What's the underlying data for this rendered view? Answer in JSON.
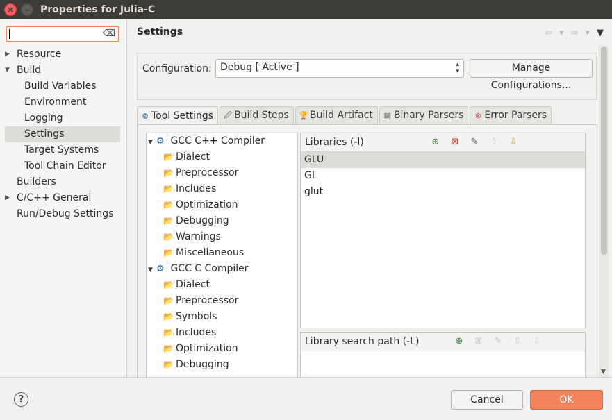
{
  "window": {
    "title": "Properties for Julia-C",
    "close_glyph": "×",
    "minimize_glyph": "–"
  },
  "filter": {
    "value": "",
    "clear_glyph": "⌫"
  },
  "sidebar": {
    "items": [
      {
        "label": "Resource",
        "arrow": "▶"
      },
      {
        "label": "Build",
        "arrow": "▼"
      },
      {
        "label": "Build Variables",
        "arrow": ""
      },
      {
        "label": "Environment",
        "arrow": ""
      },
      {
        "label": "Logging",
        "arrow": ""
      },
      {
        "label": "Settings",
        "arrow": ""
      },
      {
        "label": "Target Systems",
        "arrow": ""
      },
      {
        "label": "Tool Chain Editor",
        "arrow": ""
      },
      {
        "label": "Builders",
        "arrow": ""
      },
      {
        "label": "C/C++ General",
        "arrow": "▶"
      },
      {
        "label": "Run/Debug Settings",
        "arrow": ""
      }
    ],
    "selected": "Settings"
  },
  "main": {
    "title": "Settings",
    "nav": {
      "back": "⇦",
      "back_menu": "▾",
      "forward": "⇨",
      "forward_menu": "▾",
      "view_menu": "▼"
    },
    "configuration": {
      "label": "Configuration:",
      "value": "Debug  [ Active ]",
      "manage_label": "Manage Configurations...",
      "spinner_glyph": "▴▾"
    },
    "tabs": [
      {
        "label": "Tool Settings",
        "icon": "⚙"
      },
      {
        "label": "Build Steps",
        "icon": "🖉"
      },
      {
        "label": "Build Artifact",
        "icon": "🏆"
      },
      {
        "label": "Binary Parsers",
        "icon": "▤"
      },
      {
        "label": "Error Parsers",
        "icon": "⊗"
      }
    ],
    "tree": [
      {
        "label": "GCC C++ Compiler",
        "level": 0
      },
      {
        "label": "Dialect",
        "level": 1
      },
      {
        "label": "Preprocessor",
        "level": 1
      },
      {
        "label": "Includes",
        "level": 1
      },
      {
        "label": "Optimization",
        "level": 1
      },
      {
        "label": "Debugging",
        "level": 1
      },
      {
        "label": "Warnings",
        "level": 1
      },
      {
        "label": "Miscellaneous",
        "level": 1
      },
      {
        "label": "GCC C Compiler",
        "level": 0
      },
      {
        "label": "Dialect",
        "level": 1
      },
      {
        "label": "Preprocessor",
        "level": 1
      },
      {
        "label": "Symbols",
        "level": 1
      },
      {
        "label": "Includes",
        "level": 1
      },
      {
        "label": "Optimization",
        "level": 1
      },
      {
        "label": "Debugging",
        "level": 1
      }
    ],
    "tree_glyphs": {
      "expanded": "▼",
      "gear": "⚙",
      "folder": "📂"
    },
    "libraries": {
      "title": "Libraries (-l)",
      "items": [
        "GLU",
        "GL",
        "glut"
      ],
      "selected": "GLU"
    },
    "library_paths": {
      "title": "Library search path (-L)",
      "items": []
    },
    "library_tools": {
      "add": "⊕",
      "delete": "⊠",
      "edit": "✎",
      "up": "⇧",
      "down": "⇩"
    },
    "scrollbar_down": "▼"
  },
  "footer": {
    "help_glyph": "?",
    "cancel_label": "Cancel",
    "ok_label": "OK"
  },
  "colors": {
    "accent": "#f3835a",
    "titlebar": "#3c3b37",
    "selection": "#dcdcd9"
  }
}
